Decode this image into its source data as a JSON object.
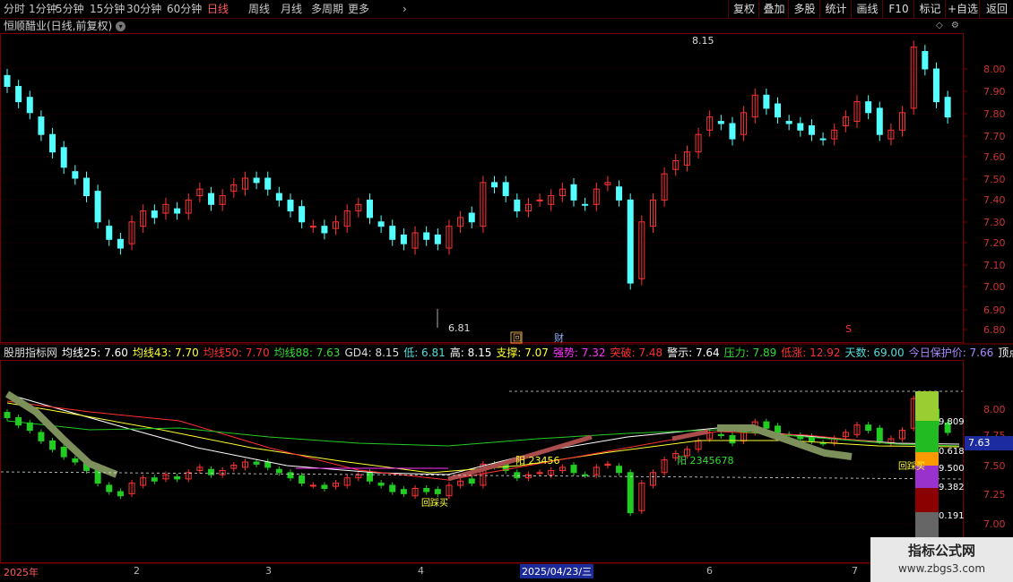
{
  "timeframes": [
    "分时",
    "1分钟",
    "5分钟",
    "15分钟",
    "30分钟",
    "60分钟",
    "日线",
    "周线",
    "月线",
    "多周期",
    "更多"
  ],
  "active_timeframe": "日线",
  "toolbar": [
    "复权",
    "叠加",
    "多股",
    "统计",
    "画线",
    "F10",
    "标记",
    "+自选",
    "返回"
  ],
  "stock_title": "恒顺醋业(日线,前复权)",
  "main_axis": [
    "8.00",
    "7.90",
    "7.80",
    "7.70",
    "7.60",
    "7.50",
    "7.40",
    "7.30",
    "7.20",
    "7.10",
    "7.00",
    "6.90",
    "6.80"
  ],
  "high_label": "8.15",
  "low_label": "6.81",
  "marker_hui": "回",
  "marker_cai": "财",
  "marker_s": "S",
  "indicator": [
    {
      "t": "股朋指标网",
      "c": "#dddddd"
    },
    {
      "t": "均线25: 7.60",
      "c": "#ffffff"
    },
    {
      "t": "均线43: 7.70",
      "c": "#ffff33"
    },
    {
      "t": "均线50: 7.70",
      "c": "#ff3030"
    },
    {
      "t": "均线88: 7.63",
      "c": "#33dd33"
    },
    {
      "t": "GD4: 8.15",
      "c": "#dddddd"
    },
    {
      "t": "低: 6.81",
      "c": "#55dddd"
    },
    {
      "t": "高: 8.15",
      "c": "#ffffff"
    },
    {
      "t": "支撑: 7.07",
      "c": "#ffff33"
    },
    {
      "t": "强势: 7.32",
      "c": "#ff33ff"
    },
    {
      "t": "突破: 7.48",
      "c": "#ff3030"
    },
    {
      "t": "警示: 7.64",
      "c": "#ffffff"
    },
    {
      "t": "压力: 7.89",
      "c": "#33dd33"
    },
    {
      "t": "低涨: 12.92",
      "c": "#ff3030"
    },
    {
      "t": "天数: 69.00",
      "c": "#55dddd"
    },
    {
      "t": "今日保护价: 7.66",
      "c": "#aa88ff"
    },
    {
      "t": "顶点",
      "c": "#ffffff"
    }
  ],
  "sub_axis": [
    "8.00",
    "7.75",
    "7.50",
    "7.25",
    "7.00"
  ],
  "fib_labels": [
    "9.809",
    "0.618",
    "9.500",
    "9.382",
    "0.191"
  ],
  "current_price": "7.63",
  "hui_mai": "回踩买",
  "yang_labels": [
    "阳 23456",
    "阳 2345678"
  ],
  "dates": [
    "2025年",
    "2",
    "3",
    "4",
    "6",
    "7"
  ],
  "current_date": "2025/04/23/三",
  "watermark": {
    "title": "指标公式网",
    "url": "www.zbgs3.com"
  },
  "colors": {
    "up": "#ff3333",
    "down": "#54ffff",
    "sub_down": "#22cc22",
    "grid": "#7a0000"
  }
}
